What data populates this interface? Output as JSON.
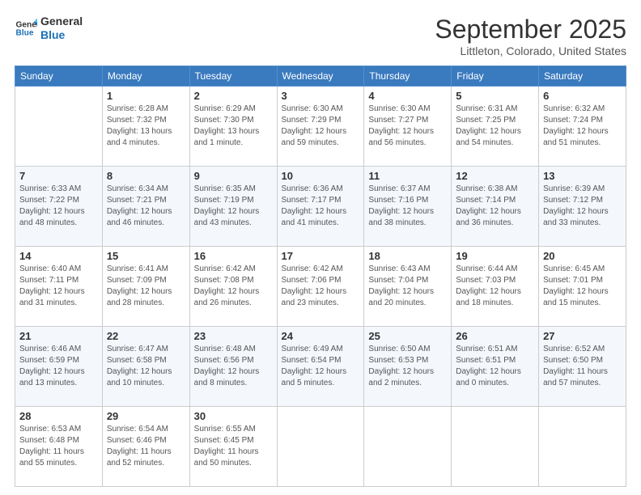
{
  "header": {
    "logo_line1": "General",
    "logo_line2": "Blue",
    "month": "September 2025",
    "location": "Littleton, Colorado, United States"
  },
  "days_of_week": [
    "Sunday",
    "Monday",
    "Tuesday",
    "Wednesday",
    "Thursday",
    "Friday",
    "Saturday"
  ],
  "weeks": [
    [
      {
        "day": "",
        "info": ""
      },
      {
        "day": "1",
        "info": "Sunrise: 6:28 AM\nSunset: 7:32 PM\nDaylight: 13 hours\nand 4 minutes."
      },
      {
        "day": "2",
        "info": "Sunrise: 6:29 AM\nSunset: 7:30 PM\nDaylight: 13 hours\nand 1 minute."
      },
      {
        "day": "3",
        "info": "Sunrise: 6:30 AM\nSunset: 7:29 PM\nDaylight: 12 hours\nand 59 minutes."
      },
      {
        "day": "4",
        "info": "Sunrise: 6:30 AM\nSunset: 7:27 PM\nDaylight: 12 hours\nand 56 minutes."
      },
      {
        "day": "5",
        "info": "Sunrise: 6:31 AM\nSunset: 7:25 PM\nDaylight: 12 hours\nand 54 minutes."
      },
      {
        "day": "6",
        "info": "Sunrise: 6:32 AM\nSunset: 7:24 PM\nDaylight: 12 hours\nand 51 minutes."
      }
    ],
    [
      {
        "day": "7",
        "info": "Sunrise: 6:33 AM\nSunset: 7:22 PM\nDaylight: 12 hours\nand 48 minutes."
      },
      {
        "day": "8",
        "info": "Sunrise: 6:34 AM\nSunset: 7:21 PM\nDaylight: 12 hours\nand 46 minutes."
      },
      {
        "day": "9",
        "info": "Sunrise: 6:35 AM\nSunset: 7:19 PM\nDaylight: 12 hours\nand 43 minutes."
      },
      {
        "day": "10",
        "info": "Sunrise: 6:36 AM\nSunset: 7:17 PM\nDaylight: 12 hours\nand 41 minutes."
      },
      {
        "day": "11",
        "info": "Sunrise: 6:37 AM\nSunset: 7:16 PM\nDaylight: 12 hours\nand 38 minutes."
      },
      {
        "day": "12",
        "info": "Sunrise: 6:38 AM\nSunset: 7:14 PM\nDaylight: 12 hours\nand 36 minutes."
      },
      {
        "day": "13",
        "info": "Sunrise: 6:39 AM\nSunset: 7:12 PM\nDaylight: 12 hours\nand 33 minutes."
      }
    ],
    [
      {
        "day": "14",
        "info": "Sunrise: 6:40 AM\nSunset: 7:11 PM\nDaylight: 12 hours\nand 31 minutes."
      },
      {
        "day": "15",
        "info": "Sunrise: 6:41 AM\nSunset: 7:09 PM\nDaylight: 12 hours\nand 28 minutes."
      },
      {
        "day": "16",
        "info": "Sunrise: 6:42 AM\nSunset: 7:08 PM\nDaylight: 12 hours\nand 26 minutes."
      },
      {
        "day": "17",
        "info": "Sunrise: 6:42 AM\nSunset: 7:06 PM\nDaylight: 12 hours\nand 23 minutes."
      },
      {
        "day": "18",
        "info": "Sunrise: 6:43 AM\nSunset: 7:04 PM\nDaylight: 12 hours\nand 20 minutes."
      },
      {
        "day": "19",
        "info": "Sunrise: 6:44 AM\nSunset: 7:03 PM\nDaylight: 12 hours\nand 18 minutes."
      },
      {
        "day": "20",
        "info": "Sunrise: 6:45 AM\nSunset: 7:01 PM\nDaylight: 12 hours\nand 15 minutes."
      }
    ],
    [
      {
        "day": "21",
        "info": "Sunrise: 6:46 AM\nSunset: 6:59 PM\nDaylight: 12 hours\nand 13 minutes."
      },
      {
        "day": "22",
        "info": "Sunrise: 6:47 AM\nSunset: 6:58 PM\nDaylight: 12 hours\nand 10 minutes."
      },
      {
        "day": "23",
        "info": "Sunrise: 6:48 AM\nSunset: 6:56 PM\nDaylight: 12 hours\nand 8 minutes."
      },
      {
        "day": "24",
        "info": "Sunrise: 6:49 AM\nSunset: 6:54 PM\nDaylight: 12 hours\nand 5 minutes."
      },
      {
        "day": "25",
        "info": "Sunrise: 6:50 AM\nSunset: 6:53 PM\nDaylight: 12 hours\nand 2 minutes."
      },
      {
        "day": "26",
        "info": "Sunrise: 6:51 AM\nSunset: 6:51 PM\nDaylight: 12 hours\nand 0 minutes."
      },
      {
        "day": "27",
        "info": "Sunrise: 6:52 AM\nSunset: 6:50 PM\nDaylight: 11 hours\nand 57 minutes."
      }
    ],
    [
      {
        "day": "28",
        "info": "Sunrise: 6:53 AM\nSunset: 6:48 PM\nDaylight: 11 hours\nand 55 minutes."
      },
      {
        "day": "29",
        "info": "Sunrise: 6:54 AM\nSunset: 6:46 PM\nDaylight: 11 hours\nand 52 minutes."
      },
      {
        "day": "30",
        "info": "Sunrise: 6:55 AM\nSunset: 6:45 PM\nDaylight: 11 hours\nand 50 minutes."
      },
      {
        "day": "",
        "info": ""
      },
      {
        "day": "",
        "info": ""
      },
      {
        "day": "",
        "info": ""
      },
      {
        "day": "",
        "info": ""
      }
    ]
  ]
}
